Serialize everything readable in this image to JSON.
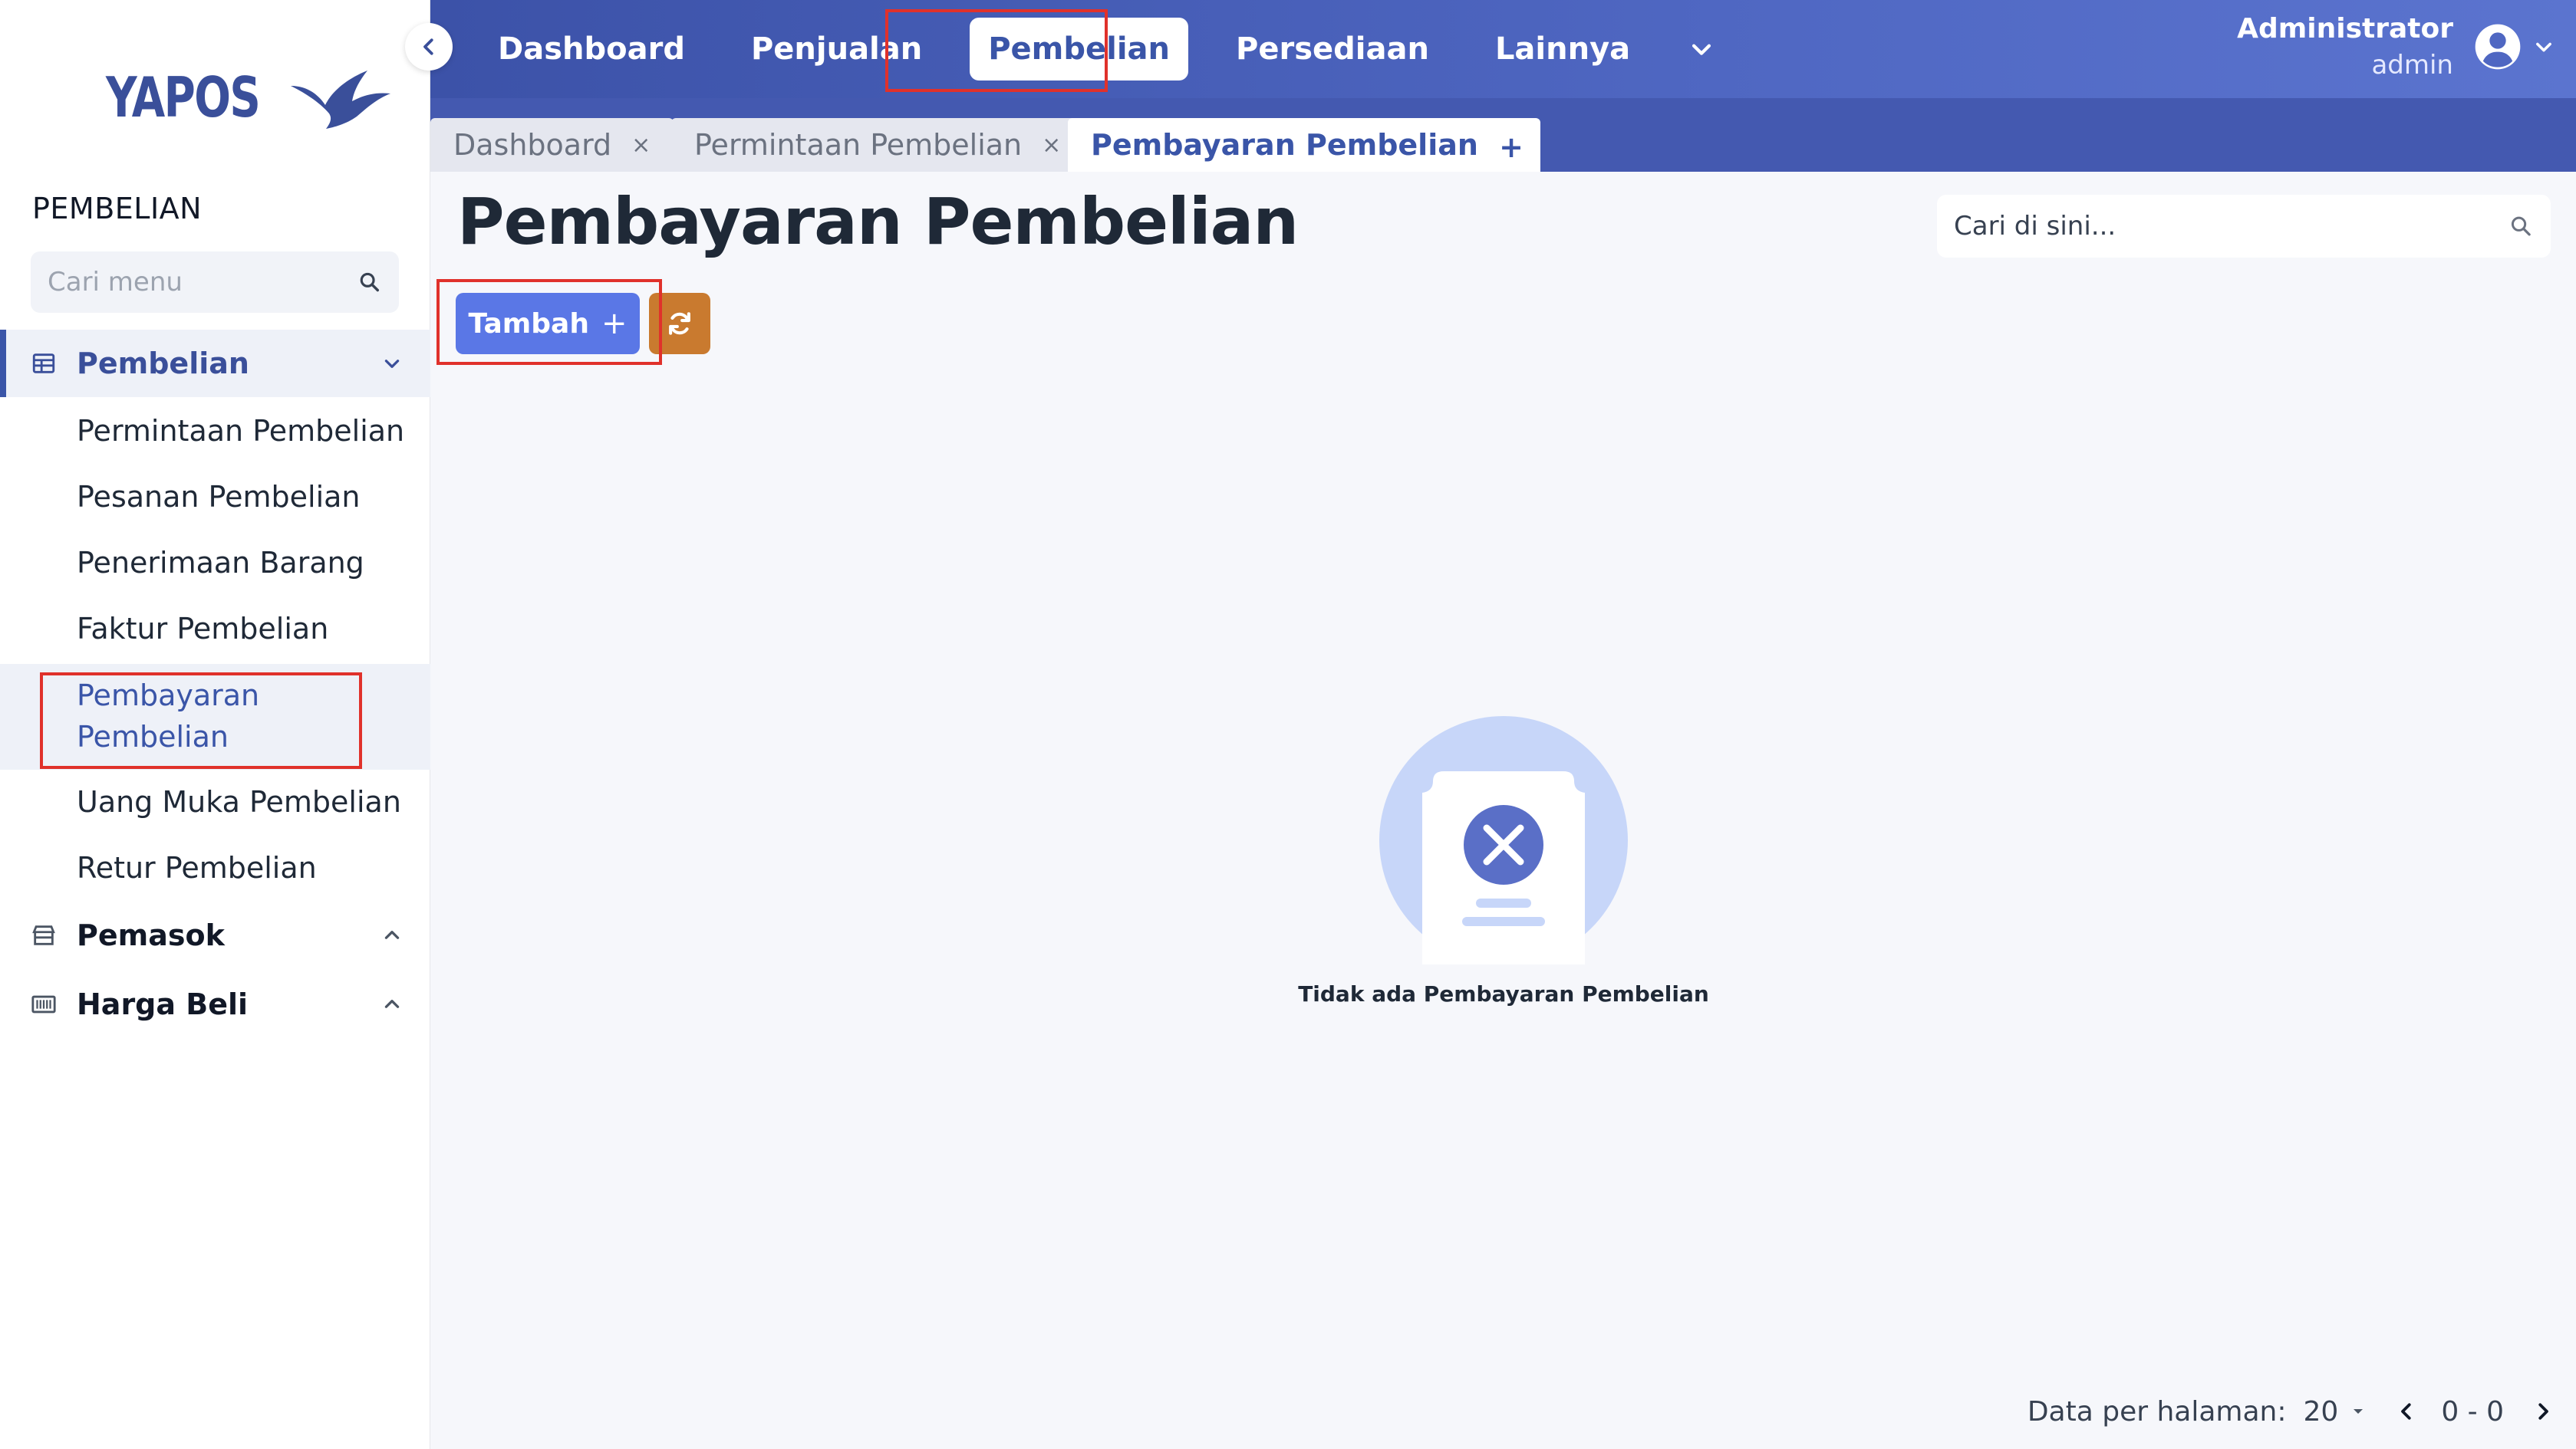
{
  "brand": {
    "name": "YAPOS"
  },
  "sidebar": {
    "section_title": "PEMBELIAN",
    "search_placeholder": "Cari menu",
    "groups": [
      {
        "label": "Pembelian",
        "icon": "table-icon",
        "expanded": true
      },
      {
        "label": "Pemasok",
        "icon": "store-icon",
        "expanded": false
      },
      {
        "label": "Harga Beli",
        "icon": "barcode-icon",
        "expanded": false
      }
    ],
    "items": [
      {
        "label": "Permintaan Pembelian"
      },
      {
        "label": "Pesanan Pembelian"
      },
      {
        "label": "Penerimaan Barang"
      },
      {
        "label": "Faktur Pembelian"
      },
      {
        "label": "Pembayaran Pembelian",
        "active": true
      },
      {
        "label": "Uang Muka Pembelian"
      },
      {
        "label": "Retur Pembelian"
      }
    ]
  },
  "topnav": {
    "items": [
      {
        "label": "Dashboard"
      },
      {
        "label": "Penjualan"
      },
      {
        "label": "Pembelian",
        "active": true
      },
      {
        "label": "Persediaan"
      },
      {
        "label": "Lainnya"
      }
    ]
  },
  "user": {
    "name": "Administrator",
    "role": "admin"
  },
  "tabs": [
    {
      "label": "Dashboard",
      "close": "×"
    },
    {
      "label": "Permintaan Pembelian",
      "close": "×"
    },
    {
      "label": "Pembayaran Pembelian",
      "close": "×",
      "active": true
    }
  ],
  "tab_add": "+",
  "main": {
    "title": "Pembayaran Pembelian",
    "search_placeholder": "Cari di sini...",
    "add_label": "Tambah",
    "add_plus": "+",
    "empty_text": "Tidak ada Pembayaran Pembelian"
  },
  "pagination": {
    "per_page_label": "Data per halaman:",
    "per_page_value": "20",
    "range": "0 - 0"
  },
  "colors": {
    "primary": "#3a55a8",
    "topbar": "#4f67c2",
    "add_button": "#5a77e6",
    "refresh_button": "#c97a2f",
    "highlight": "#e0312b"
  }
}
